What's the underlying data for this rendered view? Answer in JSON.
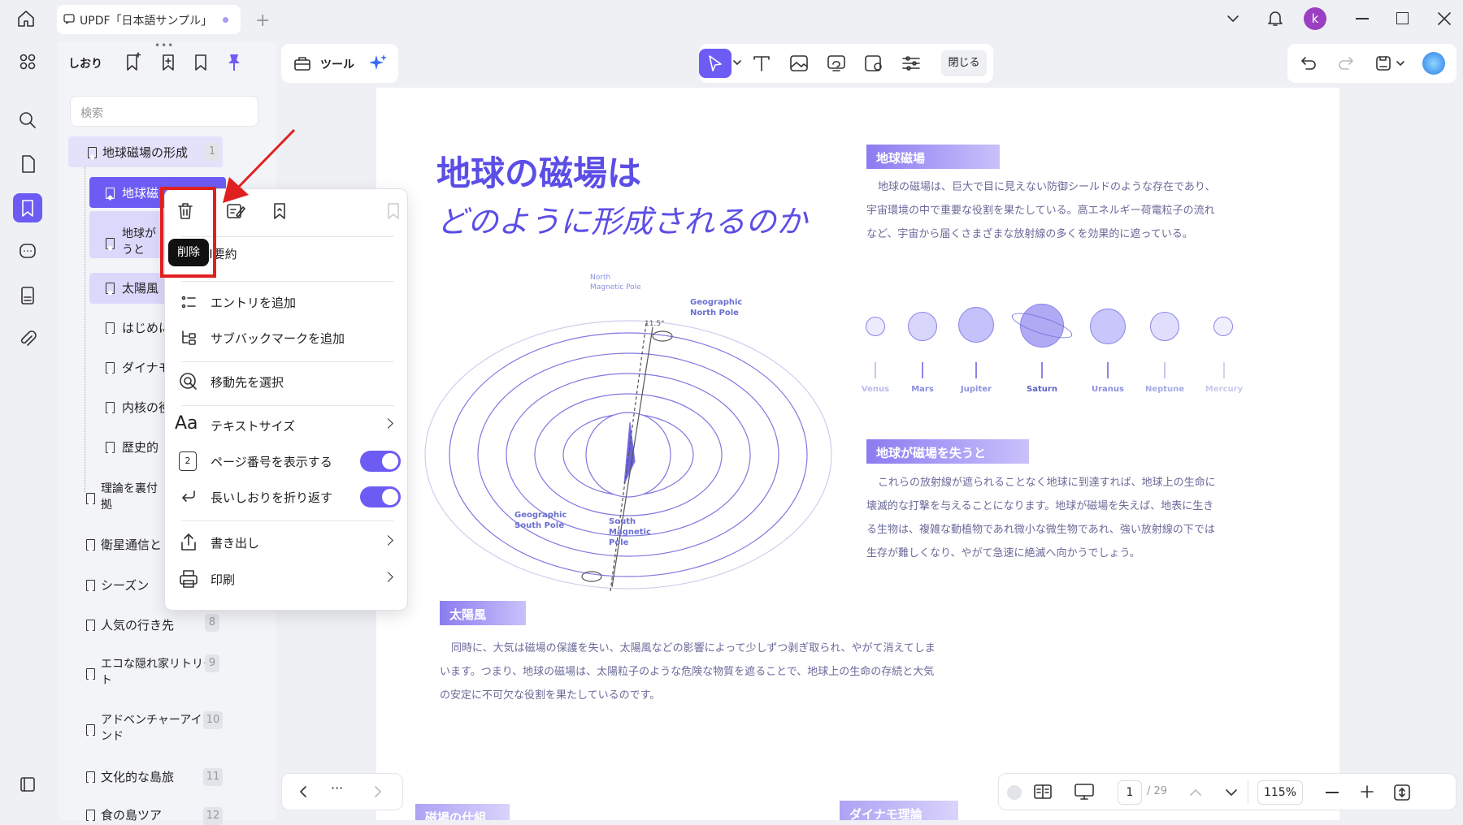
{
  "tab": {
    "title": "UPDF「日本語サンプル」"
  },
  "user": {
    "avatar_letter": "k"
  },
  "panel": {
    "title": "しおり",
    "search_placeholder": "検索",
    "items": [
      {
        "label": "地球磁場の形成",
        "page": "1"
      },
      {
        "label": "地球磁",
        "page": ""
      },
      {
        "label": "地球が\nうと",
        "page": ""
      },
      {
        "label": "太陽風",
        "page": ""
      },
      {
        "label": "はじめに",
        "page": ""
      },
      {
        "label": "ダイナモ",
        "page": ""
      },
      {
        "label": "内核の役",
        "page": ""
      },
      {
        "label": "歴史的",
        "page": ""
      },
      {
        "label": "理論を裏付\n拠",
        "page": ""
      },
      {
        "label": "衛星通信と",
        "page": ""
      },
      {
        "label": "シーズン",
        "page": ""
      },
      {
        "label": "人気の行き先",
        "page": "8"
      },
      {
        "label": "エコな隠れ家リトリー\nト",
        "page": "9"
      },
      {
        "label": "アドベンチャーアイラ\nンド",
        "page": "10"
      },
      {
        "label": "文化的な島旅",
        "page": "11"
      },
      {
        "label": "食の島ツア",
        "page": "12"
      }
    ]
  },
  "toolbar": {
    "tools_label": "ツール",
    "close_label": "閉じる"
  },
  "context_menu": {
    "tooltip": "削除",
    "summary": "AI要約",
    "add_entry": "エントリを追加",
    "add_sub": "サブバックマークを追加",
    "select_dest": "移動先を選択",
    "text_size": "テキストサイズ",
    "show_page": "ページ番号を表示する",
    "wrap": "長いしおりを折り返す",
    "export": "書き出し",
    "print": "印刷"
  },
  "document": {
    "title_line1": "地球の磁場は",
    "title_line2": "どのように形成されるのか",
    "sec1_label": "地球磁場",
    "sec1_text": [
      "地球の磁場は、巨大で目に見えない防御シールドのような存在であり、",
      "宇宙環境の中で重要な役割を果たしている。高エネルギー荷電粒子の流れ",
      "など、宇宙から届くさまざまな放射線の多くを効果的に遮っている。"
    ],
    "sec2_label": "地球が磁場を失うと",
    "sec2_text": [
      "これらの放射線が遮られることなく地球に到達すれば、地球上の生命に",
      "壊滅的な打撃を与えることになります。地球が磁場を失えば、地表に生き",
      "る生物は、複雑な動植物であれ微小な微生物であれ、強い放射線の下では",
      "生存が難しくなり、やがて急速に絶滅へ向かうでしょう。"
    ],
    "sec3_label": "太陽風",
    "sec3_text": [
      "同時に、大気は磁場の保護を失い、太陽風などの影響によって少しずつ剥ぎ取られ、やがて消えてしま",
      "います。つまり、地球の磁場は、太陽粒子のような危険な物質を遮ることで、地球上の生命の存続と大気",
      "の安定に不可欠な役割を果たしているのです。"
    ],
    "diagram": {
      "north_magnetic": "North\nMagnetic Pole",
      "geo_north": "Geographic\nNorth Pole",
      "tilt": "11.5°",
      "geo_south": "Geographic\nSouth Pole",
      "south_magnetic": "South\nMagnetic\nPole"
    },
    "planets": [
      "Venus",
      "Mars",
      "Jupiter",
      "Saturn",
      "Uranus",
      "Neptune",
      "Mercury"
    ],
    "next_labels": [
      "磁場の仕組",
      "ダイナモ理論"
    ]
  },
  "bottom": {
    "page_current": "1",
    "page_total": "/ 29",
    "zoom": "115%"
  }
}
